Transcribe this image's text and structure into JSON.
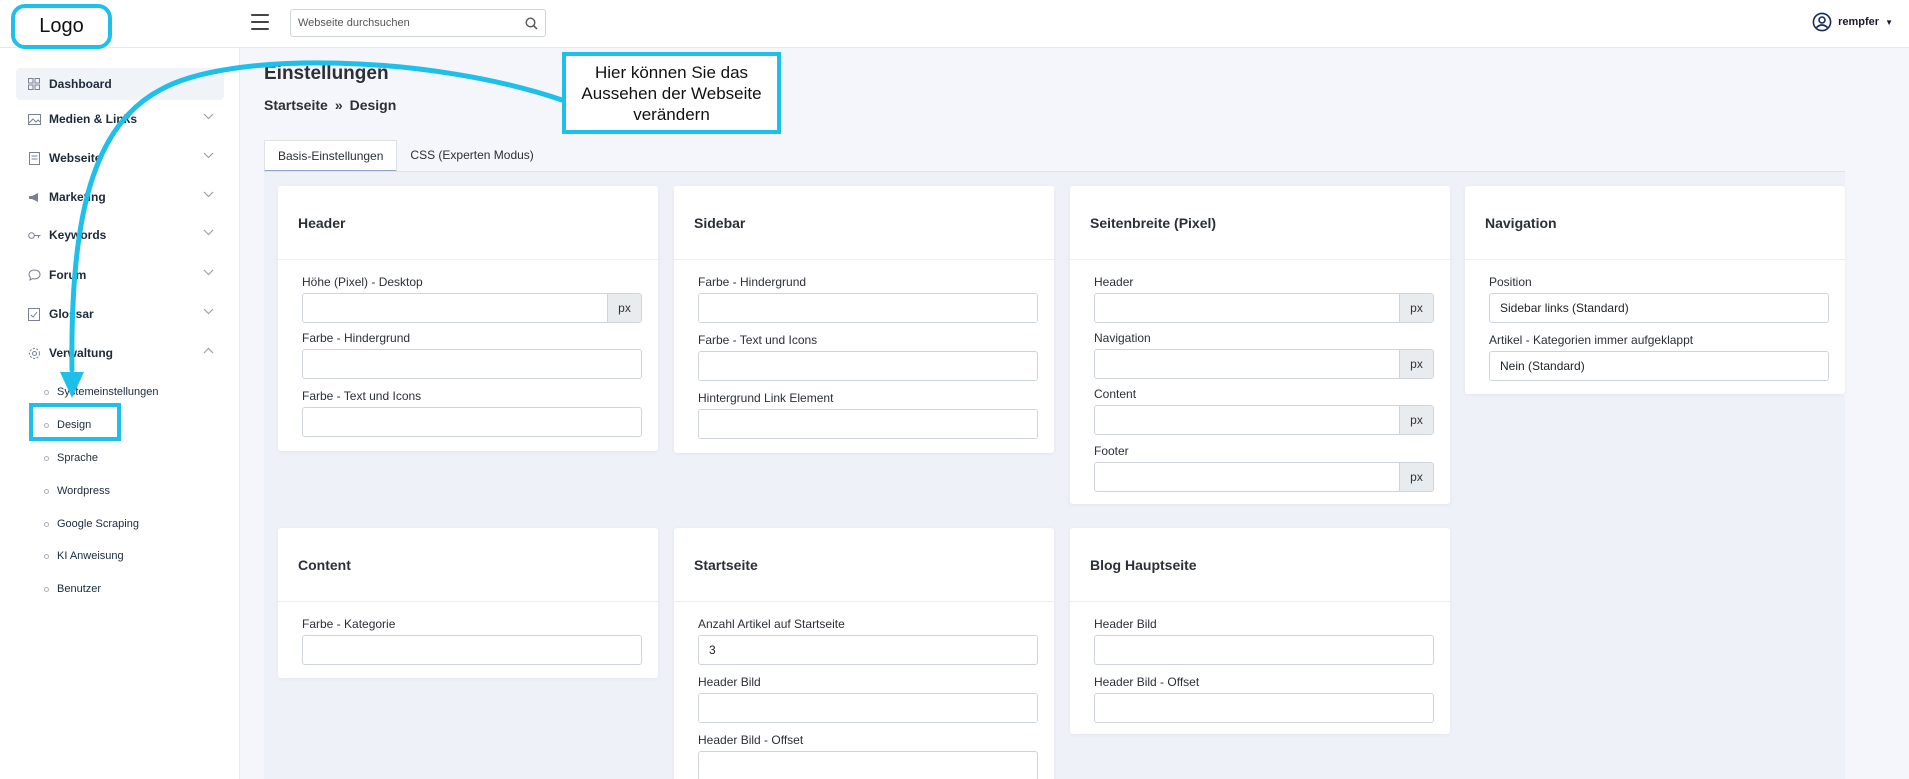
{
  "app": {
    "logo": "Logo"
  },
  "topbar": {
    "search_placeholder": "Webseite durchsuchen",
    "username": "rempfer"
  },
  "sidebar": {
    "items": [
      {
        "label": "Dashboard",
        "icon": "grid-icon"
      },
      {
        "label": "Medien & Links",
        "icon": "image-icon"
      },
      {
        "label": "Webseite",
        "icon": "page-icon"
      },
      {
        "label": "Marketing",
        "icon": "megaphone-icon"
      },
      {
        "label": "Keywords",
        "icon": "key-icon"
      },
      {
        "label": "Forum",
        "icon": "chat-icon"
      },
      {
        "label": "Glossar",
        "icon": "book-icon"
      },
      {
        "label": "Verwaltung",
        "icon": "gear-icon"
      }
    ],
    "subitems": [
      "Systemeinstellungen",
      "Design",
      "Sprache",
      "Wordpress",
      "Google Scraping",
      "KI Anweisung",
      "Benutzer"
    ]
  },
  "page": {
    "title": "Einstellungen",
    "breadcrumb": [
      "Startseite",
      "»",
      "Design"
    ],
    "tabs": [
      "Basis-Einstellungen",
      "CSS (Experten Modus)"
    ]
  },
  "callout": "Hier können Sie das Aussehen der Webseite verändern",
  "unit": "px",
  "cards": {
    "header": {
      "title": "Header",
      "fields": [
        "Höhe (Pixel) - Desktop",
        "Farbe - Hindergrund",
        "Farbe - Text und Icons"
      ]
    },
    "sidebar": {
      "title": "Sidebar",
      "fields": [
        "Farbe - Hindergrund",
        "Farbe - Text und Icons",
        "Hintergrund Link Element"
      ]
    },
    "seitenbreite": {
      "title": "Seitenbreite (Pixel)",
      "fields": [
        "Header",
        "Navigation",
        "Content",
        "Footer"
      ]
    },
    "navigation": {
      "title": "Navigation",
      "fields": [
        "Position",
        "Artikel - Kategorien immer aufgeklappt"
      ],
      "values": [
        "Sidebar links (Standard)",
        "Nein (Standard)"
      ]
    },
    "content": {
      "title": "Content",
      "fields": [
        "Farbe - Kategorie"
      ]
    },
    "startseite": {
      "title": "Startseite",
      "fields": [
        "Anzahl Artikel auf Startseite",
        "Header Bild",
        "Header Bild - Offset"
      ],
      "values": [
        "3"
      ]
    },
    "blog": {
      "title": "Blog Hauptseite",
      "fields": [
        "Header Bild",
        "Header Bild - Offset"
      ]
    }
  },
  "colors": {
    "accent": "#1ec0ea",
    "background": "#f4f6fb"
  }
}
